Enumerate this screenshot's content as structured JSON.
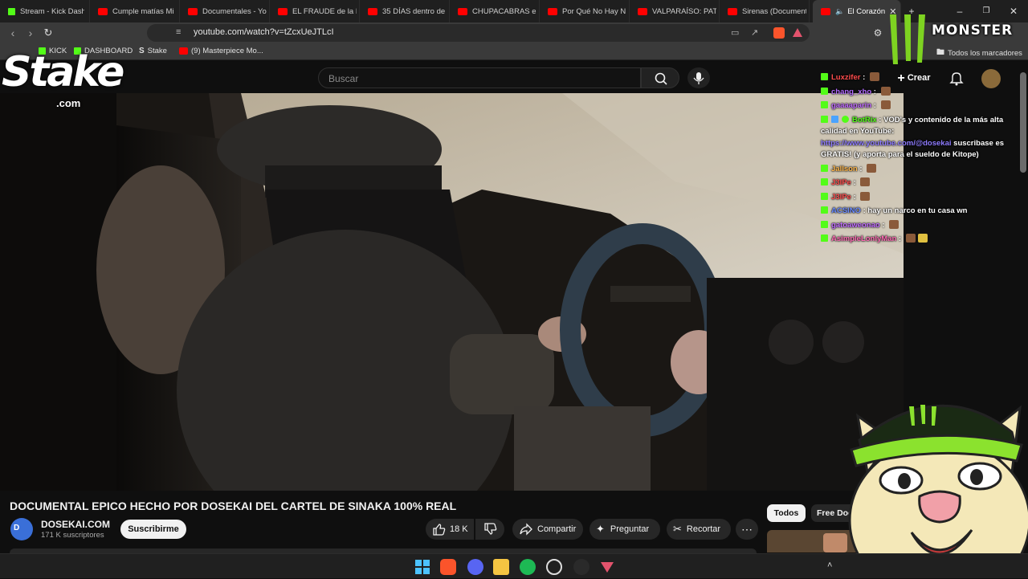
{
  "browser": {
    "tabs": [
      {
        "label": "Stream - Kick Dash",
        "favicon": "kick"
      },
      {
        "label": "Cumple matías Mi",
        "favicon": "youtube"
      },
      {
        "label": "Documentales - Yo",
        "favicon": "youtube"
      },
      {
        "label": "EL FRAUDE de la FI",
        "favicon": "youtube"
      },
      {
        "label": "35 DÍAS dentro de",
        "favicon": "youtube"
      },
      {
        "label": "CHUPACABRAS en",
        "favicon": "youtube"
      },
      {
        "label": "Por Qué No Hay N",
        "favicon": "youtube"
      },
      {
        "label": "VALPARAÍSO: PATR",
        "favicon": "youtube"
      },
      {
        "label": "Sirenas (Document",
        "favicon": "youtube"
      },
      {
        "label": "El Corazón",
        "favicon": "youtube",
        "active": true
      }
    ],
    "url": "youtube.com/watch?v=tZcxUeJTLcI",
    "bookmarks": [
      {
        "label": "KICK",
        "icon": "kick-icon"
      },
      {
        "label": "DASHBOARD",
        "icon": "kick-icon"
      },
      {
        "label": "Stake",
        "icon": "stake-icon"
      },
      {
        "label": "(9) Masterpiece Mo...",
        "icon": "youtube-icon"
      }
    ],
    "all_bookmarks_label": "Todos los marcadores"
  },
  "youtube": {
    "search_placeholder": "Buscar",
    "create_label": "Crear",
    "video_title": "DOCUMENTAL EPICO HECHO POR DOSEKAI DEL CARTEL DE SINAKA 100% REAL",
    "channel": {
      "name": "DOSEKAI.COM",
      "subscribers": "171 K suscriptores",
      "subscribe_label": "Suscribirme"
    },
    "actions": {
      "likes": "18 K",
      "share_label": "Compartir",
      "ask_label": "Preguntar",
      "clip_label": "Recortar"
    },
    "chips": {
      "all": "Todos",
      "free_doc": "Free Doc"
    }
  },
  "overlay": {
    "stake_text": "Stake",
    "stake_com": ".com",
    "monster_text": "MONSTER",
    "chat": [
      {
        "user": "Luxzifer",
        "color": "#ff4d4d",
        "text": "",
        "emote": true
      },
      {
        "user": "chang_xho",
        "color": "#b46bff",
        "text": "",
        "emote": true
      },
      {
        "user": "gaaaaparin",
        "color": "#c06bff",
        "text": "",
        "emote": true
      },
      {
        "user": "BotRix",
        "color": "#53fc18",
        "text": "VOD's y contenido de la más alta calidad en YouTube:",
        "link": "https://www.youtube.com/@dosekai",
        "after": "suscribase es GRATIS! (y aporta para el sueldo de Kitope)",
        "badges": true
      },
      {
        "user": "Jallson",
        "color": "#ffb84d",
        "text": "",
        "emote": true
      },
      {
        "user": "J3IPe",
        "color": "#ff4d4d",
        "text": "",
        "emote": true
      },
      {
        "user": "J3IPe",
        "color": "#ff4d4d",
        "text": "",
        "emote": true
      },
      {
        "user": "ACSINO",
        "color": "#6b8bff",
        "text": "hay un narco en tu casa wn",
        "emote": false
      },
      {
        "user": "gatoaweonao",
        "color": "#c06bff",
        "text": "",
        "emote": true
      },
      {
        "user": "AsimpleLonlyMan",
        "color": "#ff6bb4",
        "text": "",
        "emote": true
      }
    ]
  },
  "colors": {
    "kick_green": "#53fc18",
    "youtube_red": "#ff0000",
    "background": "#0f0f0f"
  }
}
